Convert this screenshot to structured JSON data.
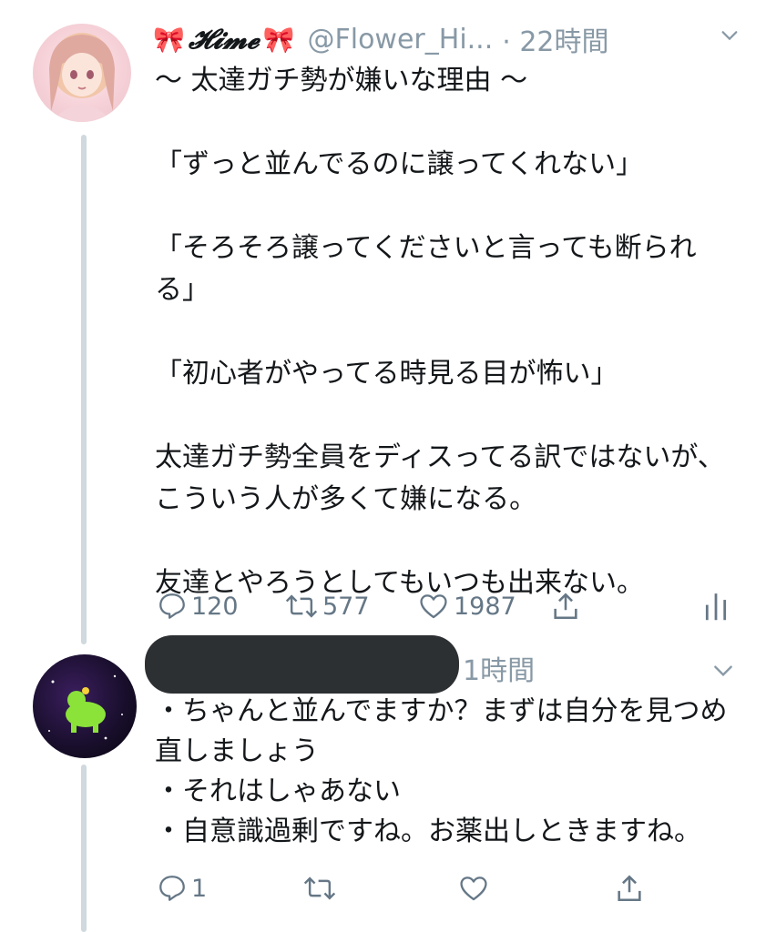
{
  "tweet": {
    "ribbon_left": "🎀",
    "display_name": "𝓗𝓲𝓶𝓮",
    "ribbon_right": "🎀",
    "handle": "@Flower_Hi...",
    "time": "· 22時間",
    "text": "〜 太達ガチ勢が嫌いな理由 〜\n\n「ずっと並んでるのに譲ってくれない」\n\n「そろそろ譲ってくださいと言っても断られる」\n\n「初心者がやってる時見る目が怖い」\n\n太達ガチ勢全員をディスってる訳ではないが、こういう人が多くて嫌になる。\n\n友達とやろうとしてもいつも出来ない。",
    "reply_count": "120",
    "retweet_count": "577",
    "like_count": "1987"
  },
  "reply": {
    "time": "1時間",
    "text": "・ちゃんと並んでますか？まずは自分を見つめ直しましょう\n・それはしゃあない\n・自意識過剰ですね。お薬出しときますね。",
    "reply_count": "1"
  },
  "icons": {
    "reply": "reply-icon",
    "retweet": "retweet-icon",
    "like": "heart-icon",
    "share": "share-icon",
    "analytics": "analytics-icon",
    "caret": "chevron-down-icon"
  },
  "colors": {
    "muted": "#8899a6",
    "icon": "#657786",
    "thread_line": "#cfd9de",
    "ribbon": "#e85b8a"
  }
}
